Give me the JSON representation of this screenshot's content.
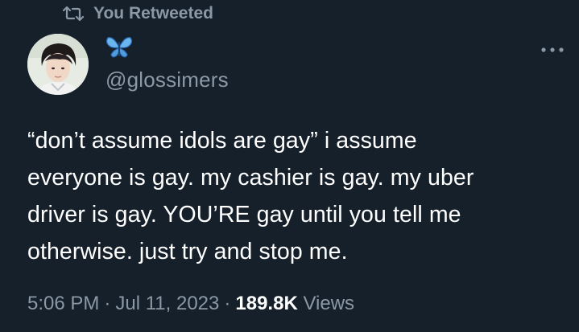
{
  "retweet_context": {
    "label": "You Retweeted",
    "icon": "retweet-icon"
  },
  "author": {
    "display_name_icon": "butterfly-emoji-icon",
    "handle": "@glossimers",
    "avatar": "avatar-photo"
  },
  "more_menu": {
    "icon": "more-horizontal-icon"
  },
  "tweet": {
    "text_lines": [
      "“don’t assume idols are gay” i assume",
      "everyone is gay. my cashier is gay. my uber",
      "driver is gay. YOU’RE gay until you tell me",
      "otherwise. just try and stop me."
    ]
  },
  "meta": {
    "time": "5:06 PM",
    "separator": "·",
    "date": "Jul 11, 2023",
    "views_count": "189.8K",
    "views_label": "Views"
  },
  "colors": {
    "background": "#15202b",
    "text_primary": "#ffffff",
    "text_secondary": "#8b98a5",
    "butterfly": "#5aa9e6"
  }
}
